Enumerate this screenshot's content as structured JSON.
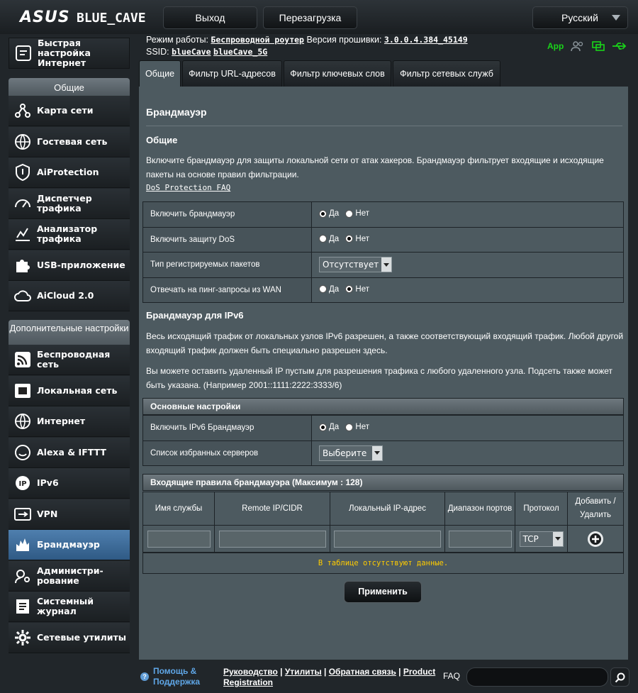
{
  "header": {
    "brand": "ASUS",
    "model": "BLUE_CAVE",
    "logout_label": "Выход",
    "reboot_label": "Перезагрузка",
    "language": "Русский"
  },
  "status": {
    "mode_label": "Режим работы:",
    "mode_value": "Беспроводной роутер",
    "fw_label": "Версия прошивки:",
    "fw_value": "3.0.0.4.384_45149",
    "ssid_label": "SSID:",
    "ssid_1": "blueCave",
    "ssid_2": "blueCave_5G",
    "app_label": "App"
  },
  "sidebar": {
    "quick_setup": "Быстрая настройка Интернет",
    "general_header": "Общие",
    "advanced_header": "Дополнительные настройки",
    "general_items": [
      {
        "label": "Карта сети",
        "icon": "network-map-icon"
      },
      {
        "label": "Гостевая сеть",
        "icon": "globe-icon"
      },
      {
        "label": "AiProtection",
        "icon": "shield-icon"
      },
      {
        "label": "Диспетчер трафика",
        "icon": "gauge-icon"
      },
      {
        "label": "Анализатор трафика",
        "icon": "chart-icon"
      },
      {
        "label": "USB-приложение",
        "icon": "puzzle-icon"
      },
      {
        "label": "AiCloud 2.0",
        "icon": "cloud-icon"
      }
    ],
    "advanced_items": [
      {
        "label": "Беспроводная сеть",
        "icon": "wifi-icon"
      },
      {
        "label": "Локальная сеть",
        "icon": "lan-icon"
      },
      {
        "label": "Интернет",
        "icon": "globe-icon"
      },
      {
        "label": "Alexa & IFTTT",
        "icon": "alexa-icon"
      },
      {
        "label": "IPv6",
        "icon": "ipv6-icon"
      },
      {
        "label": "VPN",
        "icon": "vpn-icon"
      },
      {
        "label": "Брандмауэр",
        "icon": "firewall-icon"
      },
      {
        "label": "Администри-рование",
        "icon": "admin-icon"
      },
      {
        "label": "Системный журнал",
        "icon": "log-icon"
      },
      {
        "label": "Сетевые утилиты",
        "icon": "gear-icon"
      }
    ]
  },
  "tabs": [
    "Общие",
    "Фильтр URL-адресов",
    "Фильтр ключевых слов",
    "Фильтр сетевых служб"
  ],
  "main": {
    "title": "Брандмауэр",
    "general_heading": "Общие",
    "general_desc": "Включите брандмауэр для защиты локальной сети от атак хакеров. Брандмауэр фильтрует входящие и исходящие пакеты на основе правил фильтрации.",
    "dos_faq": "DoS Protection FAQ",
    "settings": [
      {
        "label": "Включить брандмауэр",
        "yes": "Да",
        "no": "Нет",
        "selected": "yes"
      },
      {
        "label": "Включить защиту DoS",
        "yes": "Да",
        "no": "Нет",
        "selected": "no"
      },
      {
        "label": "Тип регистрируемых пакетов",
        "select": "Отсутствует"
      },
      {
        "label": "Отвечать на пинг-запросы из WAN",
        "yes": "Да",
        "no": "Нет",
        "selected": "no"
      }
    ],
    "ipv6_heading": "Брандмауэр для IPv6",
    "ipv6_desc1": "Весь исходящий трафик от локальных узлов IPv6 разрешен, а также соответствующий входящий трафик. Любой другой входящий трафик должен быть специально разрешен здесь.",
    "ipv6_desc2": "Вы можете оставить удаленный IP пустым для разрешения трафика с любого удаленного узла. Подсеть также может быть указана. (Например 2001::1111:2222:3333/6)",
    "basic_header": "Основные настройки",
    "ipv6_enable_label": "Включить IPv6 Брандмауэр",
    "ipv6_yes": "Да",
    "ipv6_no": "Нет",
    "fav_servers_label": "Список избранных серверов",
    "fav_servers_select": "Выберите",
    "rules_header": "Входящие правила брандмауэра (Максимум : 128)",
    "columns": [
      "Имя службы",
      "Remote IP/CIDR",
      "Локальный IP-адрес",
      "Диапазон портов",
      "Протокол",
      "Добавить / Удалить"
    ],
    "protocol_value": "TCP",
    "no_data": "В таблице отсутствуют данные.",
    "apply_label": "Применить"
  },
  "footer": {
    "help": "Помощь & Поддержка",
    "link1": "Руководство",
    "link2": "Утилиты",
    "link3": "Обратная связь",
    "link4": "Product Registration",
    "faq_label": "FAQ"
  },
  "colors": {
    "accent": "#4f7fae",
    "panel": "#4d5a60",
    "nodata": "#ffcc00",
    "app": "#19d419"
  }
}
